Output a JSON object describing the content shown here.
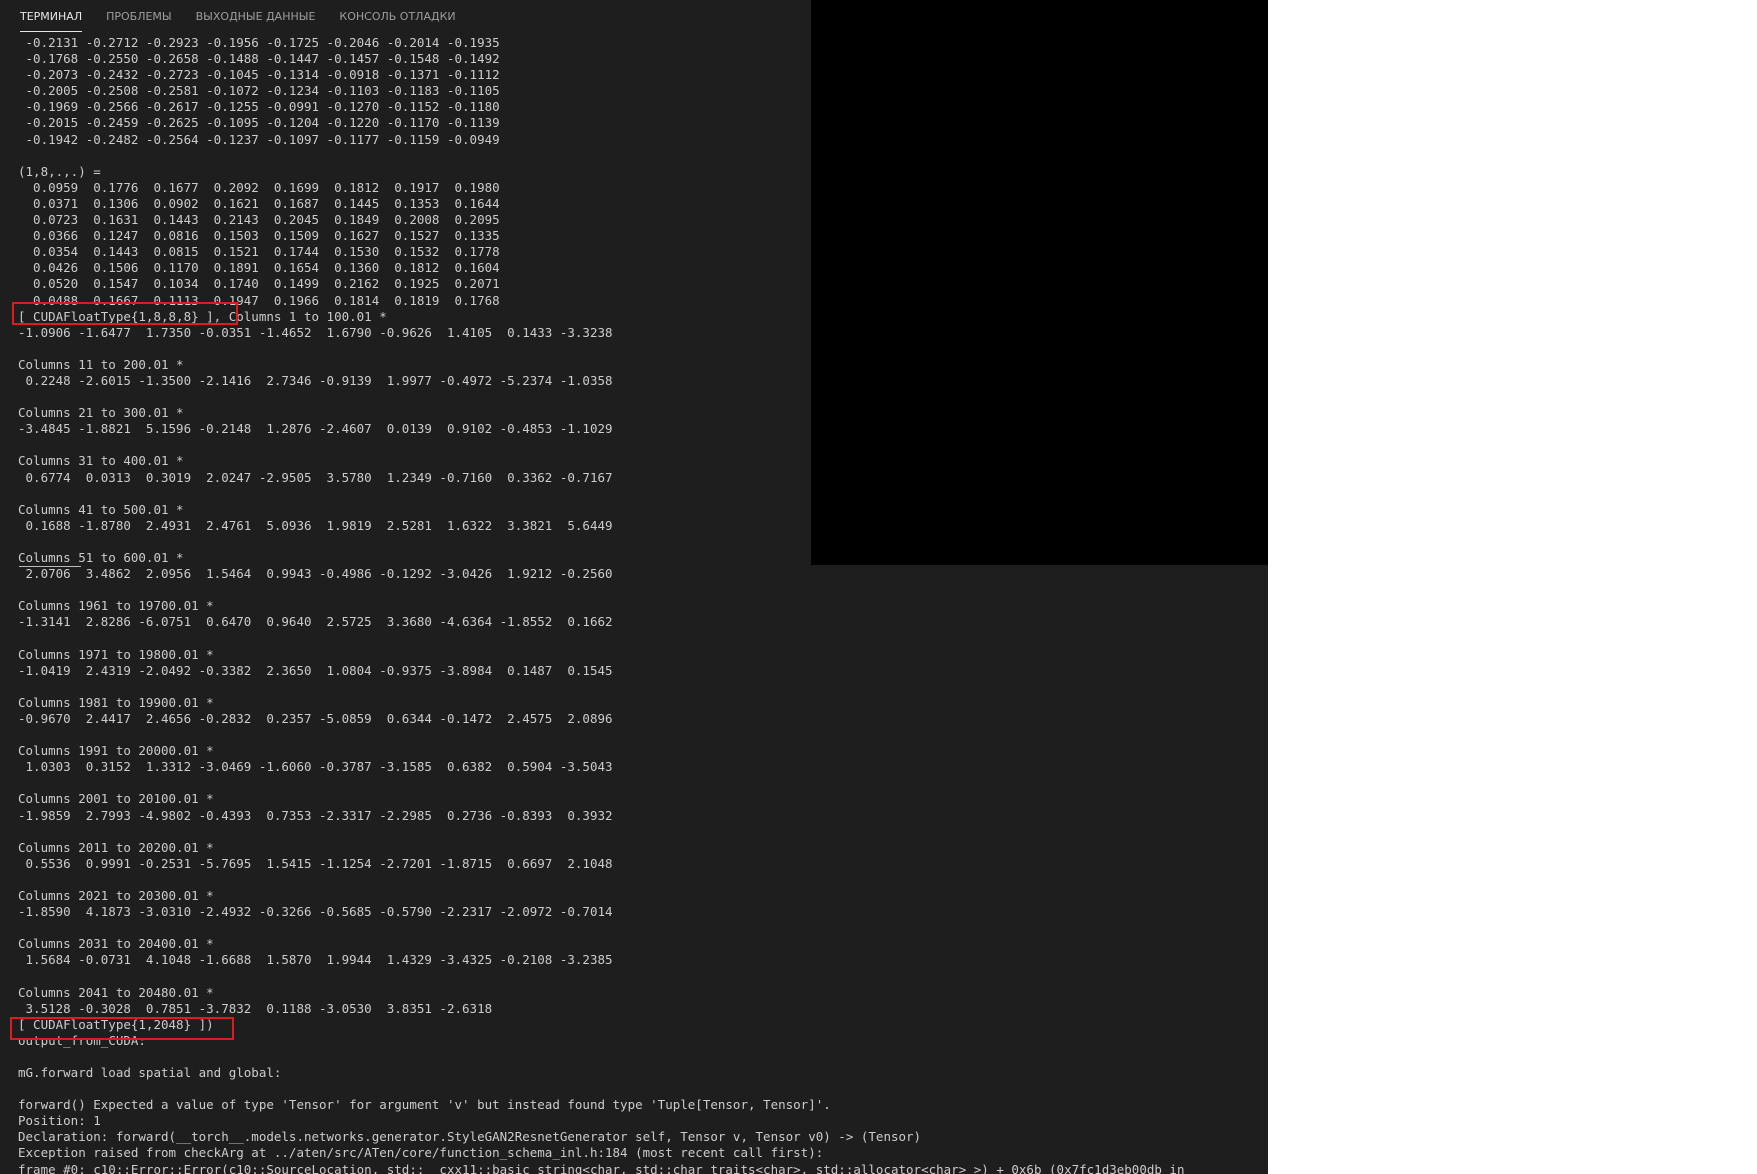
{
  "tabs": [
    {
      "label": "ТЕРМИНАЛ",
      "active": true
    },
    {
      "label": "ПРОБЛЕМЫ",
      "active": false
    },
    {
      "label": "ВЫХОДНЫЕ ДАННЫЕ",
      "active": false
    },
    {
      "label": "КОНСОЛЬ ОТЛАДКИ",
      "active": false
    }
  ],
  "terminal": {
    "lines": [
      " -0.2131 -0.2712 -0.2923 -0.1956 -0.1725 -0.2046 -0.2014 -0.1935",
      " -0.1768 -0.2550 -0.2658 -0.1488 -0.1447 -0.1457 -0.1548 -0.1492",
      " -0.2073 -0.2432 -0.2723 -0.1045 -0.1314 -0.0918 -0.1371 -0.1112",
      " -0.2005 -0.2508 -0.2581 -0.1072 -0.1234 -0.1103 -0.1183 -0.1105",
      " -0.1969 -0.2566 -0.2617 -0.1255 -0.0991 -0.1270 -0.1152 -0.1180",
      " -0.2015 -0.2459 -0.2625 -0.1095 -0.1204 -0.1220 -0.1170 -0.1139",
      " -0.1942 -0.2482 -0.2564 -0.1237 -0.1097 -0.1177 -0.1159 -0.0949",
      "",
      "(1,8,.,.) =",
      "  0.0959  0.1776  0.1677  0.2092  0.1699  0.1812  0.1917  0.1980",
      "  0.0371  0.1306  0.0902  0.1621  0.1687  0.1445  0.1353  0.1644",
      "  0.0723  0.1631  0.1443  0.2143  0.2045  0.1849  0.2008  0.2095",
      "  0.0366  0.1247  0.0816  0.1503  0.1509  0.1627  0.1527  0.1335",
      "  0.0354  0.1443  0.0815  0.1521  0.1744  0.1530  0.1532  0.1778",
      "  0.0426  0.1506  0.1170  0.1891  0.1654  0.1360  0.1812  0.1604",
      "  0.0520  0.1547  0.1034  0.1740  0.1499  0.2162  0.1925  0.2071",
      "  0.0488  0.1667  0.1113  0.1947  0.1966  0.1814  0.1819  0.1768",
      "[ CUDAFloatType{1,8,8,8} ], Columns 1 to 100.01 *",
      "-1.0906 -1.6477  1.7350 -0.0351 -1.4652  1.6790 -0.9626  1.4105  0.1433 -3.3238",
      "",
      "Columns 11 to 200.01 *",
      " 0.2248 -2.6015 -1.3500 -2.1416  2.7346 -0.9139  1.9977 -0.4972 -5.2374 -1.0358",
      "",
      "Columns 21 to 300.01 *",
      "-3.4845 -1.8821  5.1596 -0.2148  1.2876 -2.4607  0.0139  0.9102 -0.4853 -1.1029",
      "",
      "Columns 31 to 400.01 *",
      " 0.6774  0.0313  0.3019  2.0247 -2.9505  3.5780  1.2349 -0.7160  0.3362 -0.7167",
      "",
      "Columns 41 to 500.01 *",
      " 0.1688 -1.8780  2.4931  2.4761  5.0936  1.9819  2.5281  1.6322  3.3821  5.6449",
      "",
      "Columns 51 to 600.01 *",
      " 2.0706  3.4862  2.0956  1.5464  0.9943 -0.4986 -0.1292 -3.0426  1.9212 -0.2560",
      "",
      "Columns 1961 to 19700.01 *",
      "-1.3141  2.8286 -6.0751  0.6470  0.9640  2.5725  3.3680 -4.6364 -1.8552  0.1662",
      "",
      "Columns 1971 to 19800.01 *",
      "-1.0419  2.4319 -2.0492 -0.3382  2.3650  1.0804 -0.9375 -3.8984  0.1487  0.1545",
      "",
      "Columns 1981 to 19900.01 *",
      "-0.9670  2.4417  2.4656 -0.2832  0.2357 -5.0859  0.6344 -0.1472  2.4575  2.0896",
      "",
      "Columns 1991 to 20000.01 *",
      " 1.0303  0.3152  1.3312 -3.0469 -1.6060 -0.3787 -3.1585  0.6382  0.5904 -3.5043",
      "",
      "Columns 2001 to 20100.01 *",
      "-1.9859  2.7993 -4.9802 -0.4393  0.7353 -2.3317 -2.2985  0.2736 -0.8393  0.3932",
      "",
      "Columns 2011 to 20200.01 *",
      " 0.5536  0.9991 -0.2531 -5.7695  1.5415 -1.1254 -2.7201 -1.8715  0.6697  2.1048",
      "",
      "Columns 2021 to 20300.01 *",
      "-1.8590  4.1873 -3.0310 -2.4932 -0.3266 -0.5685 -0.5790 -2.2317 -2.0972 -0.7014",
      "",
      "Columns 2031 to 20400.01 *",
      " 1.5684 -0.0731  4.1048 -1.6688  1.5870  1.9944  1.4329 -3.4325 -0.2108 -3.2385",
      "",
      "Columns 2041 to 20480.01 *",
      " 3.5128 -0.3028  0.7851 -3.7832  0.1188 -3.0530  3.8351 -2.6318",
      "[ CUDAFloatType{1,2048} ])",
      "output_from_CUDA:",
      "",
      "mG.forward load spatial and global:",
      "",
      "forward() Expected a value of type 'Tensor' for argument 'v' but instead found type 'Tuple[Tensor, Tensor]'.",
      "Position: 1",
      "Declaration: forward(__torch__.models.networks.generator.StyleGAN2ResnetGenerator self, Tensor v, Tensor v0) -> (Tensor)",
      "Exception raised from checkArg at ../aten/src/ATen/core/function_schema_inl.h:184 (most recent call first):",
      "frame #0: c10::Error::Error(c10::SourceLocation, std::__cxx11::basic_string<char, std::char_traits<char>, std::allocator<char> >) + 0x6b (0x7fc1d3eb00db in"
    ]
  }
}
